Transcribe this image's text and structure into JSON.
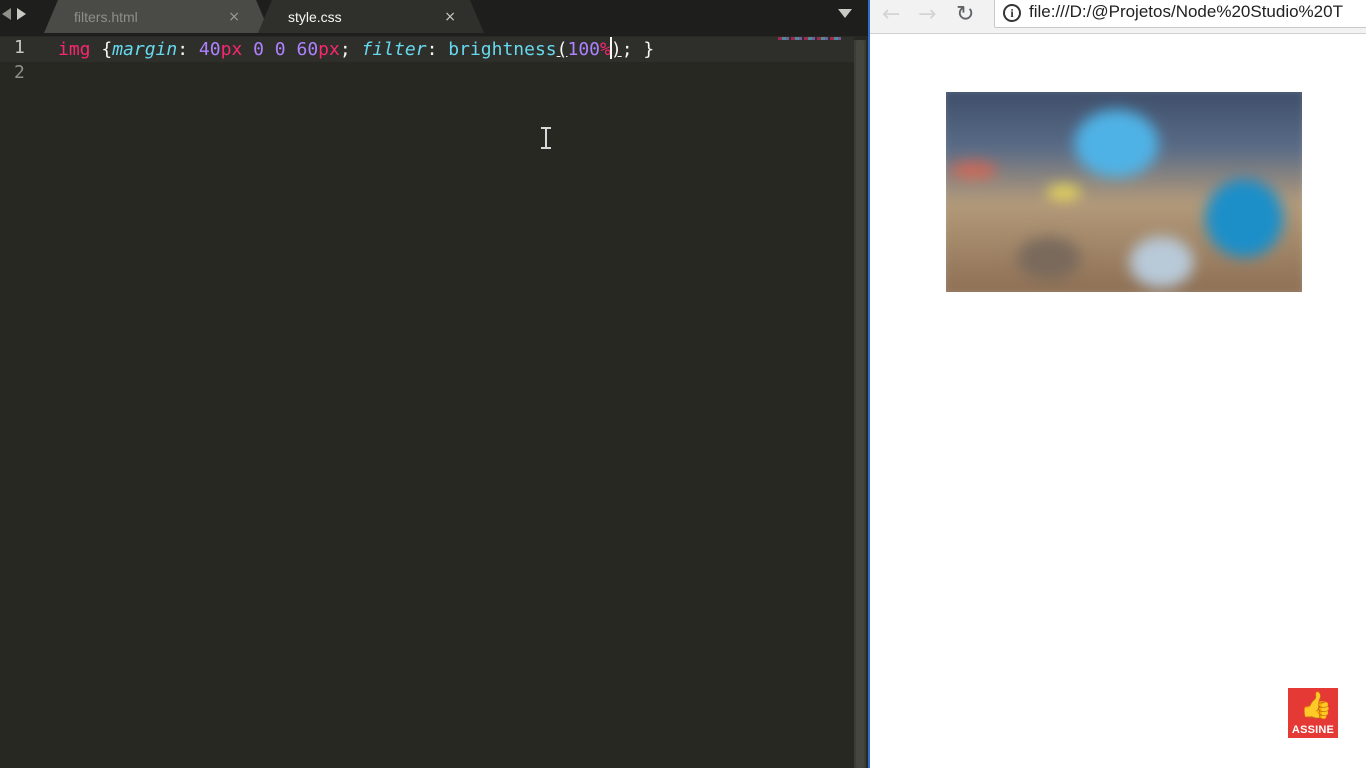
{
  "editor": {
    "tabs": [
      {
        "label": "filters.html",
        "active": false,
        "close_glyph": "×"
      },
      {
        "label": "style.css",
        "active": true,
        "close_glyph": "×"
      }
    ],
    "line_numbers": [
      "1",
      "2"
    ],
    "code_line_1": {
      "selector": "img",
      "open_brace": " {",
      "prop1": "margin",
      "colon1": ": ",
      "v1_num": "40",
      "v1_unit": "px",
      "v2": " 0 0 ",
      "v3_num": "60",
      "v3_unit": "px",
      "semi1": "; ",
      "prop2": "filter",
      "colon2": ": ",
      "func": "brightness",
      "paren_open": "(",
      "arg_num": "100",
      "arg_unit": "%",
      "paren_close": ")",
      "tail": "; }"
    },
    "icons": {
      "nav_back": "caret-left-icon",
      "nav_forward": "caret-right-icon",
      "tab_menu": "chevron-down-icon",
      "mouse_pointer": "i-beam-cursor-icon"
    }
  },
  "browser": {
    "back_glyph": "←",
    "forward_glyph": "→",
    "reload_glyph": "↻",
    "info_glyph": "i",
    "url": "file:///D:/@Projetos/Node%20Studio%20T"
  },
  "overlay": {
    "subscribe_label": "ASSINE",
    "subscribe_glyph": "👍"
  },
  "colors": {
    "editor_bg": "#272822",
    "keyword": "#f92672",
    "property": "#66d9ef",
    "number": "#ae81ff",
    "subscribe_bg": "#e53935"
  }
}
